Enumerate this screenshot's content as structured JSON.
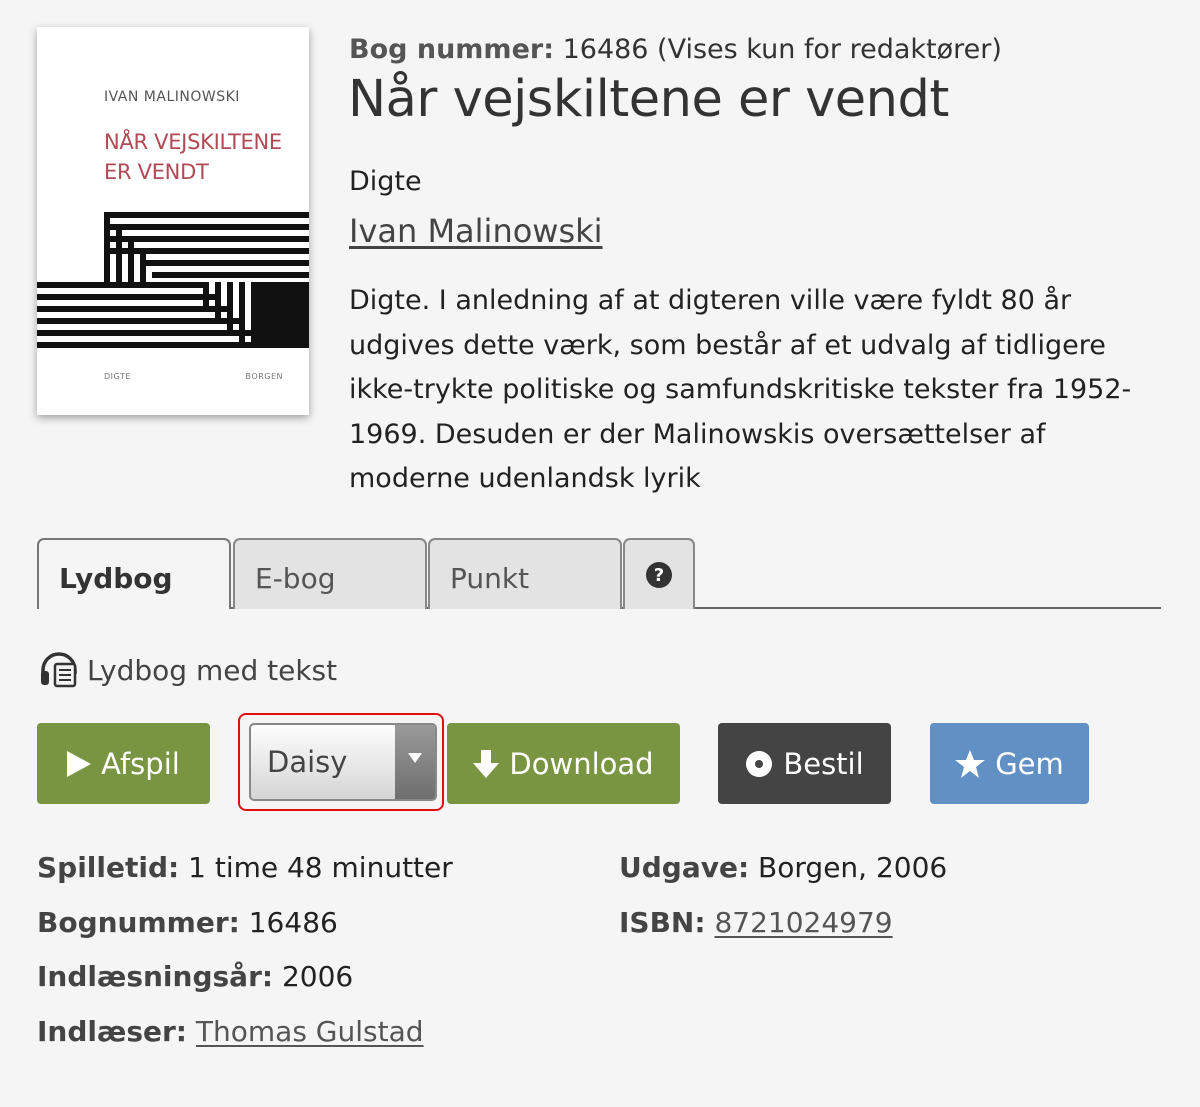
{
  "cover": {
    "author": "IVAN MALINOWSKI",
    "title_line1": "NÅR VEJSKILTENE",
    "title_line2": "ER VENDT",
    "bottom_left": "DIGTE",
    "bottom_right": "BORGEN"
  },
  "header": {
    "booknum_label": "Bog nummer:",
    "booknum_value": " 16486 (Vises kun for redaktører)",
    "title": "Når vejskiltene er vendt",
    "genre": "Digte",
    "author": "Ivan Malinowski",
    "description": "Digte. I anledning af at digteren ville være fyldt 80 år udgives dette værk, som består af et udvalg af tidligere ikke-trykte politiske og samfundskritiske tekster fra 1952-1969. Desuden er der Malinowskis oversættelser af moderne udenlandsk lyrik"
  },
  "tabs": [
    {
      "label": "Lydbog",
      "active": true
    },
    {
      "label": "E-bog",
      "active": false
    },
    {
      "label": "Punkt",
      "active": false
    },
    {
      "label": "?",
      "icon": "help-icon"
    }
  ],
  "format": {
    "icon": "headphones-book-icon",
    "label": "Lydbog med tekst"
  },
  "actions": {
    "play_label": "Afspil",
    "format_selected": "Daisy",
    "download_label": "Download",
    "order_label": "Bestil",
    "save_label": "Gem"
  },
  "details": {
    "playtime_label": "Spilletid:",
    "playtime_value": " 1 time 48 minutter",
    "booknumber_label": "Bognummer:",
    "booknumber_value": " 16486",
    "recording_year_label": "Indlæsningsår:",
    "recording_year_value": " 2006",
    "narrator_label": "Indlæser:",
    "narrator_value": "Thomas Gulstad",
    "edition_label": "Udgave:",
    "edition_value": " Borgen, 2006",
    "isbn_label": "ISBN:",
    "isbn_value": "8721024979"
  },
  "colors": {
    "green": "#7a9541",
    "dark": "#444444",
    "blue": "#6090c4",
    "focus_red": "#e01010",
    "cover_title": "#b04a55"
  }
}
